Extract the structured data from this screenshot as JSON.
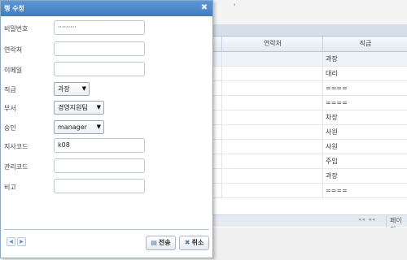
{
  "dialog": {
    "title": "행 수정",
    "fields": [
      {
        "label": "비밀번호",
        "value": "·········"
      },
      {
        "label": "연락처",
        "value": ""
      },
      {
        "label": "이메일",
        "value": ""
      },
      {
        "label": "직급",
        "value": "과장",
        "type": "select"
      },
      {
        "label": "부서",
        "value": "경영지원팀",
        "type": "select"
      },
      {
        "label": "승인",
        "value": "manager",
        "type": "select"
      },
      {
        "label": "지사코드",
        "value": "k08"
      },
      {
        "label": "관리코드",
        "value": ""
      },
      {
        "label": "비고",
        "value": ""
      }
    ],
    "buttons": {
      "submit": "전송",
      "cancel": "취소"
    },
    "icons": {
      "close": "close-icon",
      "prev": "prev-arrow-icon",
      "next": "next-arrow-icon",
      "save": "save-icon",
      "cancel": "x-icon"
    }
  },
  "grid": {
    "columns": {
      "contact": "연락처",
      "position": "직급"
    },
    "rows": [
      {
        "position": "과장"
      },
      {
        "position": "대리"
      },
      {
        "position": "===="
      },
      {
        "position": "===="
      },
      {
        "position": "차장"
      },
      {
        "position": "사원"
      },
      {
        "position": "사원"
      },
      {
        "position": "주임"
      },
      {
        "position": "과장"
      },
      {
        "position": "===="
      }
    ],
    "pager": {
      "arrows": "◂◂ ◂◂",
      "label": "페이지"
    }
  },
  "colors": {
    "titlebar": "#4a87cc",
    "accent_border": "#8fa9c9"
  }
}
